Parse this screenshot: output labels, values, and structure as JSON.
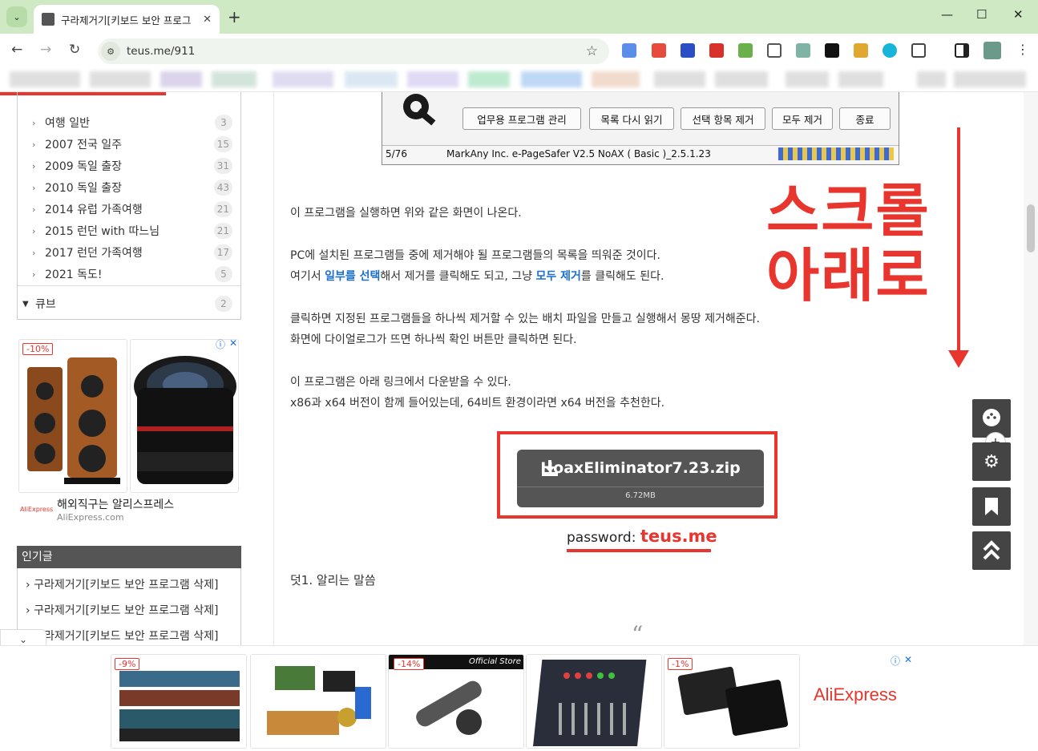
{
  "browser": {
    "tab_title": "구라제거기[키보드 보안 프로그",
    "url": "teus.me/911",
    "new_tab": "+",
    "minimize": "—",
    "maximize": "☐",
    "close": "✕"
  },
  "sidebar": {
    "categories": [
      {
        "label": "여행 일반",
        "count": "3"
      },
      {
        "label": "2007 전국 일주",
        "count": "15"
      },
      {
        "label": "2009 독일 출장",
        "count": "31"
      },
      {
        "label": "2010 독일 출장",
        "count": "43"
      },
      {
        "label": "2014 유럽 가족여행",
        "count": "21"
      },
      {
        "label": "2015 런던 with 따느님",
        "count": "21"
      },
      {
        "label": "2017 런던 가족여행",
        "count": "17"
      },
      {
        "label": "2021 독도!",
        "count": "5"
      }
    ],
    "cube": {
      "label": "큐브",
      "count": "2"
    },
    "ad": {
      "discount": "-10%",
      "caption": "해외직구는 알리스프레스",
      "sub": "AliExpress.com",
      "logo": "AliExpress"
    },
    "popular_title": "인기글",
    "popular": [
      "구라제거기[키보드 보안 프로그램 삭제]",
      "구라제거기[키보드 보안 프로그램 삭제]",
      "구라제거기[키보드 보안 프로그램 삭제]"
    ]
  },
  "program_window": {
    "buttons": [
      "업무용 프로그램 관리",
      "목록 다시 읽기",
      "선택 항목 제거",
      "모두 제거",
      "종료"
    ],
    "status_count": "5/76",
    "status_text": "MarkAny Inc. e-PageSafer V2.5 NoAX ( Basic )_2.5.1.23"
  },
  "article": {
    "p1": "이 프로그램을 실행하면 위와 같은 화면이 나온다.",
    "p2": "PC에 설치된 프로그램들 중에 제거해야 될 프로그램들의 목록을 띄워준 것이다.",
    "p3a": "여기서 ",
    "p3b": "일부를 선택",
    "p3c": "해서 제거를 클릭해도 되고, 그냥 ",
    "p3d": "모두 제거",
    "p3e": "를 클릭해도 된다.",
    "p4": "클릭하면 지정된 프로그램들을 하나씩 제거할 수 있는 배치 파일을 만들고 실행해서 몽땅 제거해준다.",
    "p5": "화면에 다이얼로그가 뜨면 하나씩 확인 버튼만 클릭하면 된다.",
    "p6": "이 프로그램은 아래 링크에서 다운받을 수 있다.",
    "p7": "x86과 x64 버전이 함께 들어있는데, 64비트 환경이라면 x64 버전을 추천한다.",
    "download_name": "HoaxEliminator7.23.zip",
    "download_size": "6.72MB",
    "password_label": "password: ",
    "password_value": "teus.me",
    "p8": "덧1. 알리는 말씀",
    "scroll_line1": "스크롤",
    "scroll_line2": "아래로"
  },
  "bottom_ad": {
    "d1": "-9%",
    "d2": "-14%",
    "d3": "-1%",
    "official": "Official Store",
    "brand": "AliExpress"
  },
  "colors": {
    "accent_red": "#e8352d",
    "link_blue": "#1a6fd1"
  }
}
